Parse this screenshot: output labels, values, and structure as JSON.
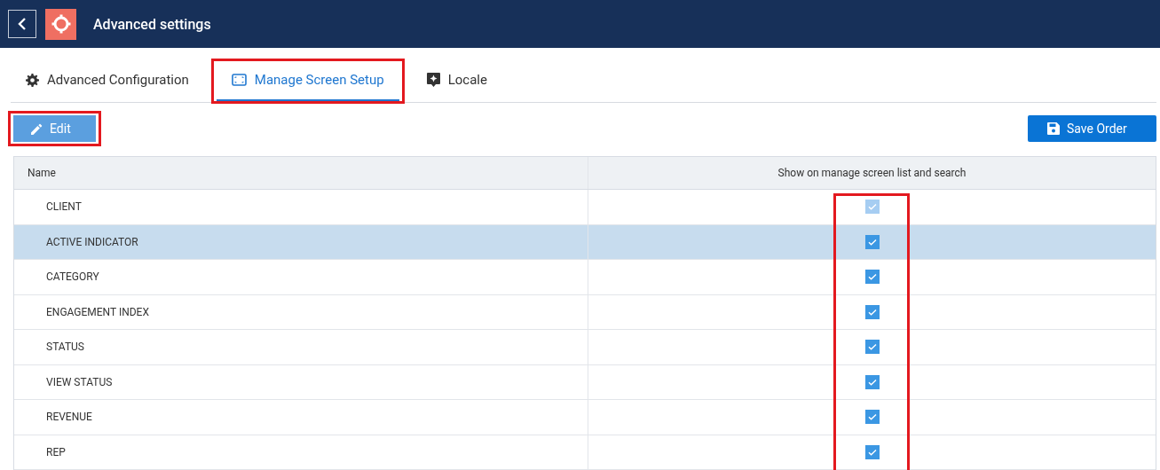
{
  "header": {
    "title": "Advanced settings"
  },
  "tabs": [
    {
      "label": "Advanced Configuration",
      "kind": "gear",
      "selected": false,
      "annotated": false
    },
    {
      "label": "Manage Screen Setup",
      "kind": "screen",
      "selected": true,
      "annotated": true
    },
    {
      "label": "Locale",
      "kind": "locale",
      "selected": false,
      "annotated": false
    }
  ],
  "toolbar": {
    "edit_button": {
      "label": "Edit",
      "annotated": true
    },
    "save_button": {
      "label": "Save Order"
    }
  },
  "table": {
    "columns": [
      "Name",
      "Show on manage screen list and search"
    ],
    "checkbox_column_annotated": true,
    "rows": [
      {
        "name": "CLIENT",
        "checked": true,
        "disabled": true,
        "selected": false
      },
      {
        "name": "ACTIVE INDICATOR",
        "checked": true,
        "disabled": false,
        "selected": true
      },
      {
        "name": "CATEGORY",
        "checked": true,
        "disabled": false,
        "selected": false
      },
      {
        "name": "ENGAGEMENT INDEX",
        "checked": true,
        "disabled": false,
        "selected": false
      },
      {
        "name": "STATUS",
        "checked": true,
        "disabled": false,
        "selected": false
      },
      {
        "name": "VIEW STATUS",
        "checked": true,
        "disabled": false,
        "selected": false
      },
      {
        "name": "REVENUE",
        "checked": true,
        "disabled": false,
        "selected": false
      },
      {
        "name": "REP",
        "checked": true,
        "disabled": false,
        "selected": false
      }
    ]
  }
}
